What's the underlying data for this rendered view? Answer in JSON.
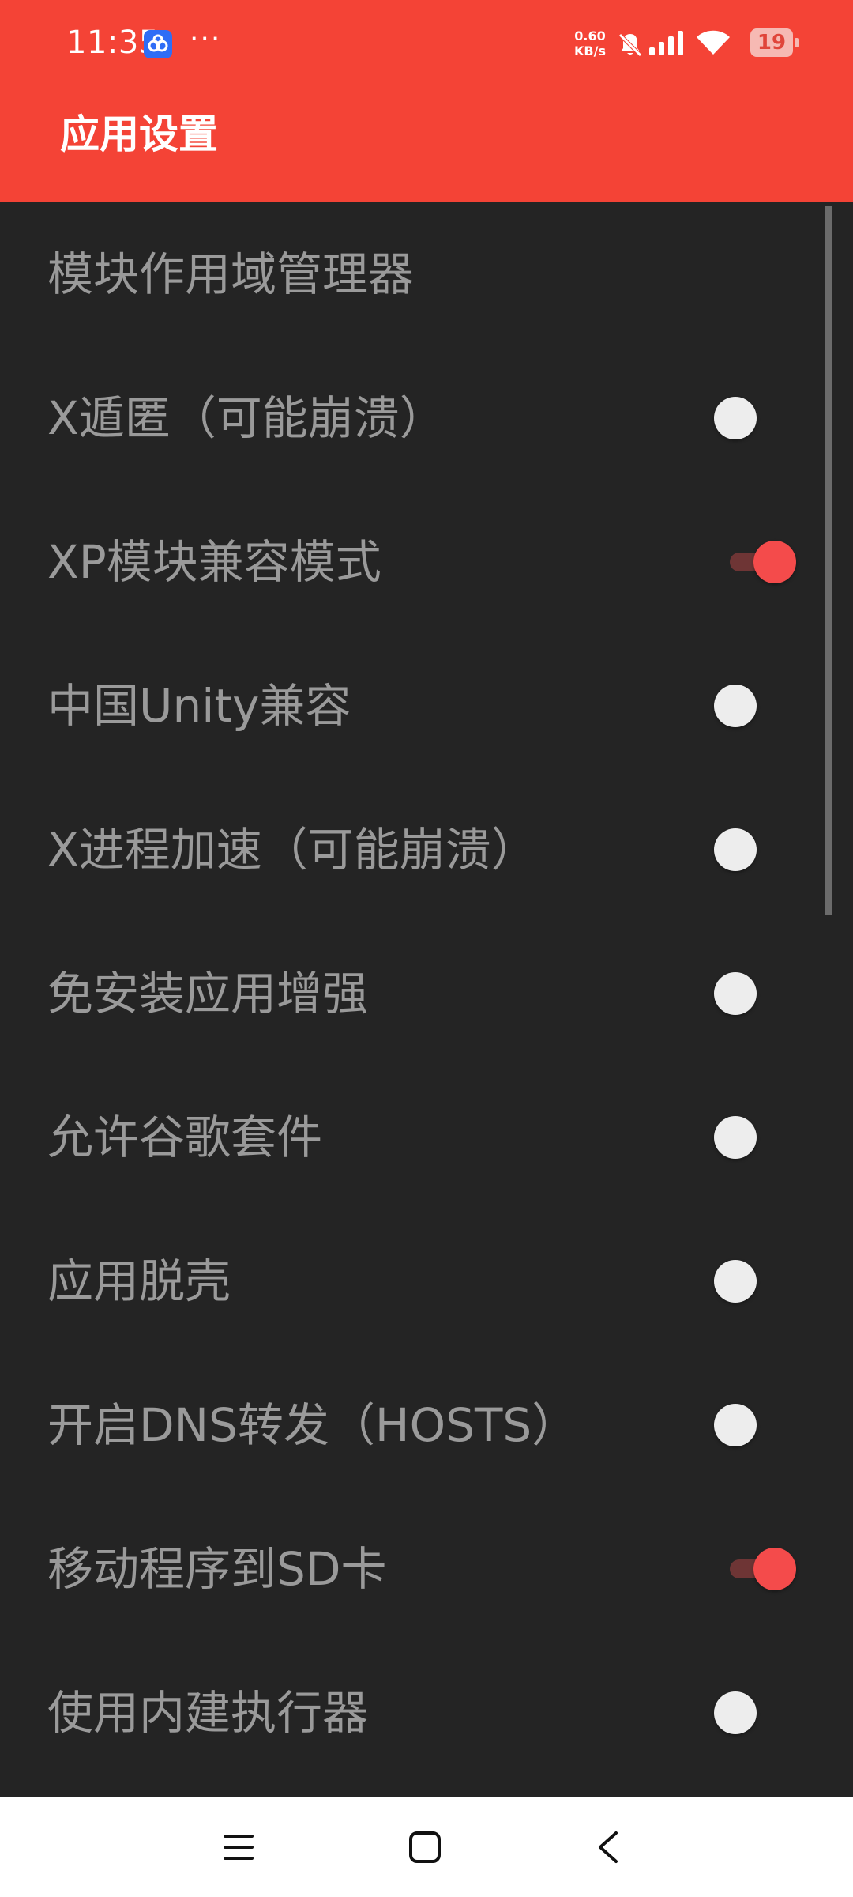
{
  "status_bar": {
    "time": "11:35",
    "more_indicator": "···",
    "net_speed_value": "0.60",
    "net_speed_unit": "KB/s",
    "battery_level": "19",
    "icons": [
      "baidu-netdisk-icon",
      "mute-bell-icon",
      "signal-icon",
      "wifi-icon",
      "battery-icon"
    ]
  },
  "appbar": {
    "title": "应用设置",
    "color": "#F44336"
  },
  "settings": {
    "items": [
      {
        "label": "模块作用域管理器",
        "toggle": null
      },
      {
        "label": "X遁匿（可能崩溃）",
        "toggle": false
      },
      {
        "label": "XP模块兼容模式",
        "toggle": true
      },
      {
        "label": "中国Unity兼容",
        "toggle": false
      },
      {
        "label": "X进程加速（可能崩溃）",
        "toggle": false
      },
      {
        "label": "免安装应用增强",
        "toggle": false
      },
      {
        "label": "允许谷歌套件",
        "toggle": false
      },
      {
        "label": "应用脱壳",
        "toggle": false
      },
      {
        "label": "开启DNS转发（HOSTS）",
        "toggle": false
      },
      {
        "label": "移动程序到SD卡",
        "toggle": true
      },
      {
        "label": "使用内建执行器",
        "toggle": false
      }
    ]
  },
  "navbar": {
    "icons": [
      "menu-icon",
      "home-icon",
      "back-icon"
    ]
  }
}
